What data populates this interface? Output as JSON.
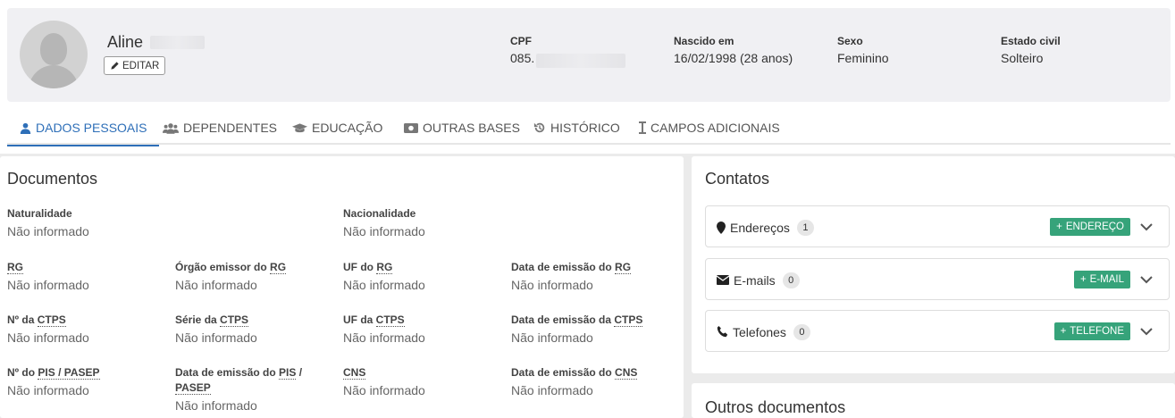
{
  "profile": {
    "name": "Aline",
    "edit_label": "EDITAR",
    "cpf_label": "CPF",
    "cpf_value": "085.",
    "birth_label": "Nascido em",
    "birth_value": "16/02/1998 (28 anos)",
    "sex_label": "Sexo",
    "sex_value": "Feminino",
    "civil_label": "Estado civil",
    "civil_value": "Solteiro"
  },
  "tabs": [
    {
      "label": "DADOS PESSOAIS",
      "icon": "user-icon",
      "active": true
    },
    {
      "label": "DEPENDENTES",
      "icon": "users-icon"
    },
    {
      "label": "EDUCAÇÃO",
      "icon": "graduation-cap-icon"
    },
    {
      "label": "OUTRAS BASES",
      "icon": "money-icon"
    },
    {
      "label": "HISTÓRICO",
      "icon": "history-icon"
    },
    {
      "label": "CAMPOS ADICIONAIS",
      "icon": "text-cursor-icon"
    }
  ],
  "documentos": {
    "title": "Documentos",
    "naturalidade": {
      "label": "Naturalidade",
      "value": "Não informado"
    },
    "nacionalidade": {
      "label": "Nacionalidade",
      "value": "Não informado"
    },
    "rg": {
      "label_abbr": "RG",
      "value": "Não informado"
    },
    "orgao_rg": {
      "label_pre": "Órgão emissor do ",
      "label_abbr": "RG",
      "value": "Não informado"
    },
    "uf_rg": {
      "label_pre": "UF do ",
      "label_abbr": "RG",
      "value": "Não informado"
    },
    "data_rg": {
      "label_pre": "Data de emissão do ",
      "label_abbr": "RG",
      "value": "Não informado"
    },
    "n_ctps": {
      "label_pre": "Nº da ",
      "label_abbr": "CTPS",
      "value": "Não informado"
    },
    "serie_ctps": {
      "label_pre": "Série da ",
      "label_abbr": "CTPS",
      "value": "Não informado"
    },
    "uf_ctps": {
      "label_pre": "UF da ",
      "label_abbr": "CTPS",
      "value": "Não informado"
    },
    "data_ctps": {
      "label_pre": "Data de emissão da ",
      "label_abbr": "CTPS",
      "value": "Não informado"
    },
    "n_pis": {
      "label_pre": "Nº do ",
      "label_abbr": "PIS / PASEP",
      "value": "Não informado"
    },
    "data_pis": {
      "label_pre": "Data de emissão do ",
      "label_abbr1": "PIS",
      "label_sep": " /",
      "label_abbr2": "PASEP",
      "value": "Não informado"
    },
    "cns": {
      "label_abbr": "CNS",
      "value": "Não informado"
    },
    "data_cns": {
      "label_pre": "Data de emissão do ",
      "label_abbr": "CNS",
      "value": "Não informado"
    }
  },
  "contatos": {
    "title": "Contatos",
    "enderecos": {
      "label": "Endereços",
      "count": "1",
      "button": "ENDEREÇO"
    },
    "emails": {
      "label": "E-mails",
      "count": "0",
      "button": "E-MAIL"
    },
    "telefones": {
      "label": "Telefones",
      "count": "0",
      "button": "TELEFONE"
    }
  },
  "outros": {
    "title": "Outros documentos"
  },
  "colors": {
    "accent": "#2e6fb8",
    "success": "#36a37a"
  }
}
